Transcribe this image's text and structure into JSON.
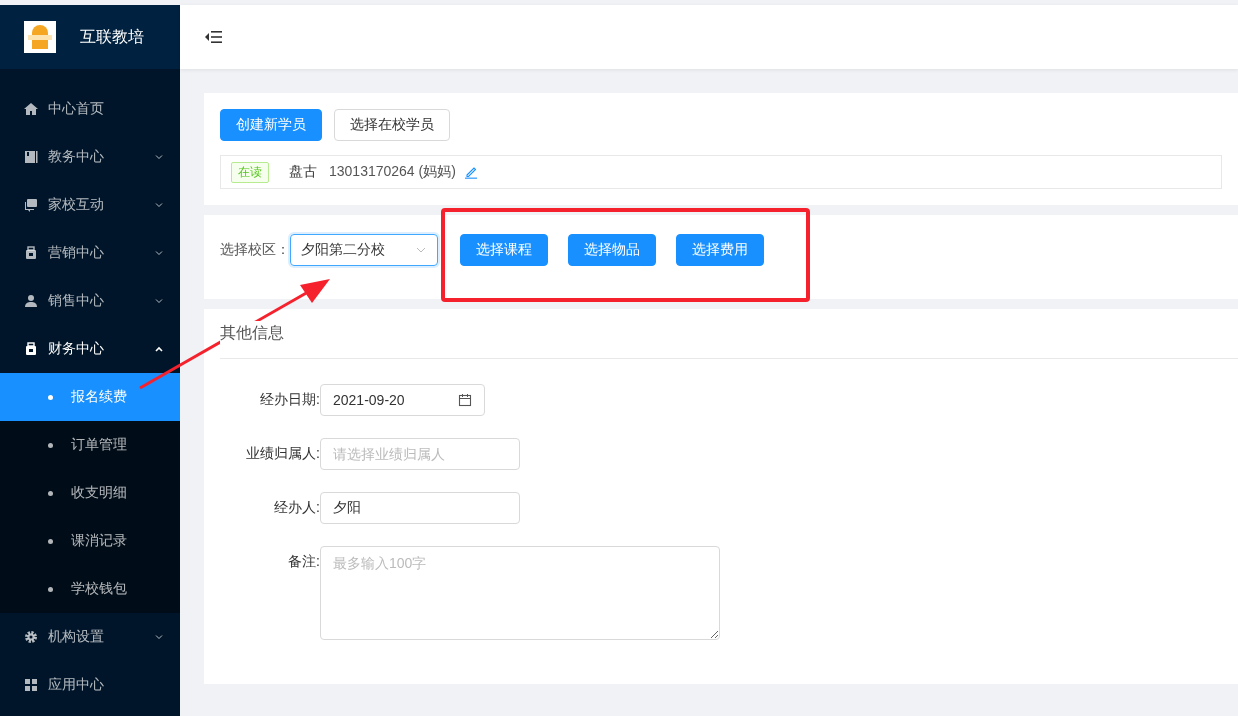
{
  "brand": {
    "name": "互联教培"
  },
  "menu": [
    {
      "label": "中心首页",
      "expanded": false,
      "has_children": false
    },
    {
      "label": "教务中心",
      "expanded": false,
      "has_children": true
    },
    {
      "label": "家校互动",
      "expanded": false,
      "has_children": true
    },
    {
      "label": "营销中心",
      "expanded": false,
      "has_children": true
    },
    {
      "label": "销售中心",
      "expanded": false,
      "has_children": true
    },
    {
      "label": "财务中心",
      "expanded": true,
      "has_children": true,
      "children": [
        {
          "label": "报名续费",
          "selected": true
        },
        {
          "label": "订单管理",
          "selected": false
        },
        {
          "label": "收支明细",
          "selected": false
        },
        {
          "label": "课消记录",
          "selected": false
        },
        {
          "label": "学校钱包",
          "selected": false
        }
      ]
    },
    {
      "label": "机构设置",
      "expanded": false,
      "has_children": true
    },
    {
      "label": "应用中心",
      "expanded": false,
      "has_children": false
    }
  ],
  "student_buttons": [
    {
      "label": "创建新学员",
      "primary": true
    },
    {
      "label": "选择在校学员",
      "primary": false
    }
  ],
  "student": {
    "status": "在读",
    "name": "盘古",
    "phone": "13013170264 (妈妈)"
  },
  "campus": {
    "label": "选择校区：",
    "value": "夕阳第二分校"
  },
  "item_buttons": [
    "选择课程",
    "选择物品",
    "选择费用"
  ],
  "other_info": {
    "title": "其他信息",
    "fields": [
      {
        "kind": "date",
        "label": "经办日期:",
        "value": "2021-09-20"
      },
      {
        "kind": "input",
        "label": "业绩归属人:",
        "placeholder": "请选择业绩归属人"
      },
      {
        "kind": "input",
        "label": "经办人:",
        "value": "夕阳"
      },
      {
        "kind": "textarea",
        "label": "备注:",
        "placeholder": "最多输入100字"
      }
    ]
  }
}
